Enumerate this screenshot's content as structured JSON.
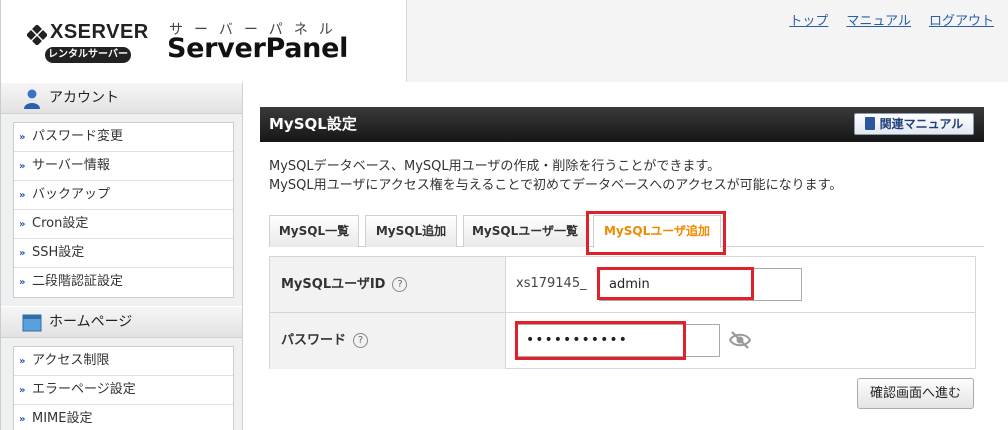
{
  "header": {
    "logo_text": "XSERVER",
    "logo_badge": "レンタルサーバー",
    "panel_kana": "サーバーパネル",
    "panel_title": "ServerPanel",
    "links": [
      "トップ",
      "マニュアル",
      "ログアウト"
    ]
  },
  "sidebar": {
    "sections": [
      {
        "title": "アカウント",
        "icon": "person-icon",
        "items": [
          "パスワード変更",
          "サーバー情報",
          "バックアップ",
          "Cron設定",
          "SSH設定",
          "二段階認証設定"
        ]
      },
      {
        "title": "ホームページ",
        "icon": "window-icon",
        "items": [
          "アクセス制限",
          "エラーページ設定",
          "MIME設定"
        ]
      }
    ]
  },
  "main": {
    "title": "MySQL設定",
    "manual_button": "関連マニュアル",
    "description": [
      "MySQLデータベース、MySQL用ユーザの作成・削除を行うことができます。",
      "MySQL用ユーザにアクセス権を与えることで初めてデータベースへのアクセスが可能になります。"
    ],
    "tabs": [
      "MySQL一覧",
      "MySQL追加",
      "MySQLユーザ一覧",
      "MySQLユーザ追加"
    ],
    "active_tab": "MySQLユーザ追加",
    "form": {
      "user_id_label": "MySQLユーザID",
      "user_id_prefix": "xs179145_",
      "user_id_value": "admin",
      "password_label": "パスワード",
      "password_value": "•••••••••••",
      "help_symbol": "?"
    },
    "confirm_button": "確認画面へ進む"
  },
  "colors": {
    "highlight": "#e0202a",
    "active_tab_text": "#f08a00",
    "link": "#2a5fa8",
    "title_bar": "#1e1e1e"
  }
}
